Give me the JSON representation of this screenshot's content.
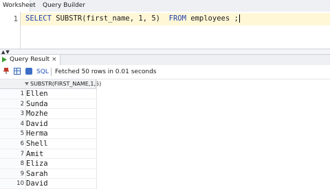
{
  "tabs": {
    "worksheet": "Worksheet",
    "query_builder": "Query Builder"
  },
  "editor": {
    "line_number": "1",
    "code": {
      "select": "SELECT",
      "func": "SUBSTR(first_name, 1, 5)",
      "from": "FROM",
      "table": "employees ;"
    }
  },
  "result_tab": {
    "label": "Query Result",
    "close": "×"
  },
  "toolbar": {
    "sql_label": "SQL",
    "status": "Fetched 50 rows in 0.01 seconds",
    "icons": [
      "pin-icon",
      "grid-icon",
      "favorite-icon"
    ]
  },
  "grid": {
    "column": "SUBSTR(FIRST_NAME,1,5)",
    "rows": [
      {
        "n": "1",
        "v": "Ellen"
      },
      {
        "n": "2",
        "v": "Sunda"
      },
      {
        "n": "3",
        "v": "Mozhe"
      },
      {
        "n": "4",
        "v": "David"
      },
      {
        "n": "5",
        "v": "Herma"
      },
      {
        "n": "6",
        "v": "Shell"
      },
      {
        "n": "7",
        "v": "Amit"
      },
      {
        "n": "8",
        "v": "Eliza"
      },
      {
        "n": "9",
        "v": "Sarah"
      },
      {
        "n": "10",
        "v": "David"
      }
    ]
  },
  "colors": {
    "keyword": "#1f3fb0",
    "current_line": "#fff7d6",
    "run_icon": "#3a9d2f"
  }
}
